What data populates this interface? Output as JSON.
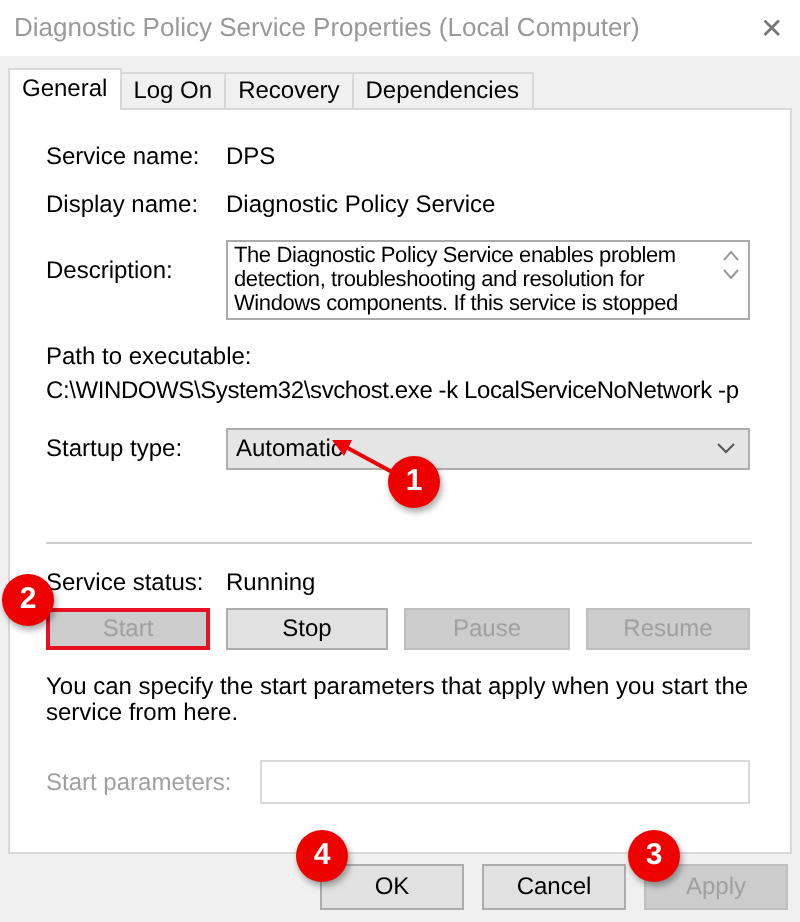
{
  "window": {
    "title": "Diagnostic Policy Service Properties (Local Computer)",
    "close": "✕"
  },
  "tabs": [
    {
      "label": "General",
      "selected": true
    },
    {
      "label": "Log On",
      "selected": false
    },
    {
      "label": "Recovery",
      "selected": false
    },
    {
      "label": "Dependencies",
      "selected": false
    }
  ],
  "fields": [
    {
      "label": "Service name:",
      "value": "DPS"
    },
    {
      "label": "Display name:",
      "value": "Diagnostic Policy Service"
    }
  ],
  "description": {
    "label": "Description:",
    "lines": [
      "The Diagnostic Policy Service enables problem",
      "detection, troubleshooting and resolution for",
      "Windows components.  If this service is stopped"
    ]
  },
  "path": {
    "label": "Path to executable:",
    "value": "C:\\WINDOWS\\System32\\svchost.exe -k LocalServiceNoNetwork -p"
  },
  "startup_type": {
    "label": "Startup type:",
    "value": "Automatic"
  },
  "service_status": {
    "label": "Service status:",
    "value": "Running"
  },
  "service_buttons": [
    {
      "label": "Start",
      "disabled": true,
      "highlighted": true
    },
    {
      "label": "Stop",
      "disabled": false,
      "highlighted": false
    },
    {
      "label": "Pause",
      "disabled": true,
      "highlighted": false
    },
    {
      "label": "Resume",
      "disabled": true,
      "highlighted": false
    }
  ],
  "hint": "You can specify the start parameters that apply when you start the service from here.",
  "start_parameters": {
    "label": "Start parameters:",
    "disabled": true
  },
  "dialog_buttons": [
    {
      "label": "OK",
      "disabled": false
    },
    {
      "label": "Cancel",
      "disabled": false
    },
    {
      "label": "Apply",
      "disabled": true
    }
  ],
  "annotations": [
    {
      "label": "1"
    },
    {
      "label": "2"
    },
    {
      "label": "3"
    },
    {
      "label": "4"
    }
  ]
}
